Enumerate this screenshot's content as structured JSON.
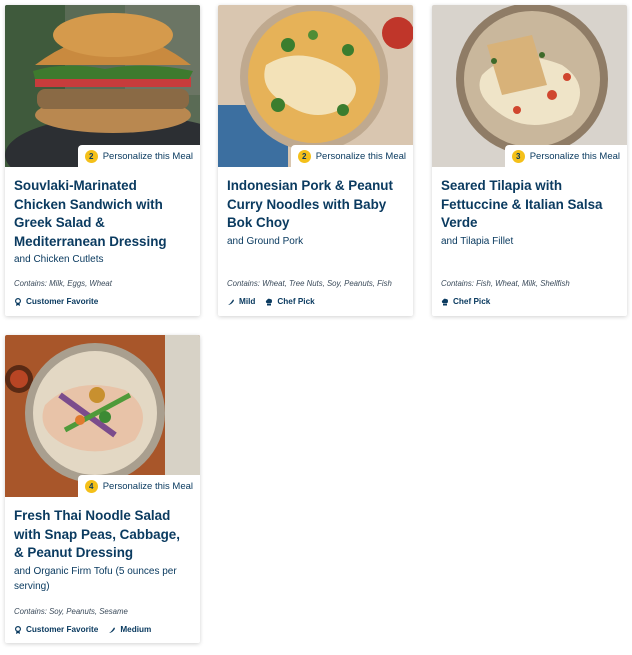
{
  "cards": [
    {
      "title": "Souvlaki-Marinated Chicken Sandwich with Greek Salad & Mediterranean Dressing",
      "subtitle": "and Chicken Cutlets",
      "personalize_count": "2",
      "personalize_label": "Personalize this Meal",
      "contains": "Contains: Milk, Eggs, Wheat",
      "tags": [
        {
          "icon": "ribbon-icon",
          "label": "Customer Favorite"
        }
      ]
    },
    {
      "title": "Indonesian Pork & Peanut Curry Noodles with Baby Bok Choy",
      "subtitle": "and Ground Pork",
      "personalize_count": "2",
      "personalize_label": "Personalize this Meal",
      "contains": "Contains: Wheat, Tree Nuts, Soy, Peanuts, Fish",
      "tags": [
        {
          "icon": "pepper-icon",
          "label": "Mild"
        },
        {
          "icon": "chef-hat-icon",
          "label": "Chef Pick"
        }
      ]
    },
    {
      "title": "Seared Tilapia with Fettuccine & Italian Salsa Verde",
      "subtitle": "and Tilapia Fillet",
      "personalize_count": "3",
      "personalize_label": "Personalize this Meal",
      "contains": "Contains: Fish, Wheat, Milk, Shellfish",
      "tags": [
        {
          "icon": "chef-hat-icon",
          "label": "Chef Pick"
        }
      ]
    },
    {
      "title": "Fresh Thai Noodle Salad with Snap Peas, Cabbage, & Peanut Dressing",
      "subtitle": "and Organic Firm Tofu (5 ounces per serving)",
      "personalize_count": "4",
      "personalize_label": "Personalize this Meal",
      "contains": "Contains: Soy, Peanuts, Sesame",
      "tags": [
        {
          "icon": "ribbon-icon",
          "label": "Customer Favorite"
        },
        {
          "icon": "pepper-icon",
          "label": "Medium"
        }
      ]
    }
  ]
}
